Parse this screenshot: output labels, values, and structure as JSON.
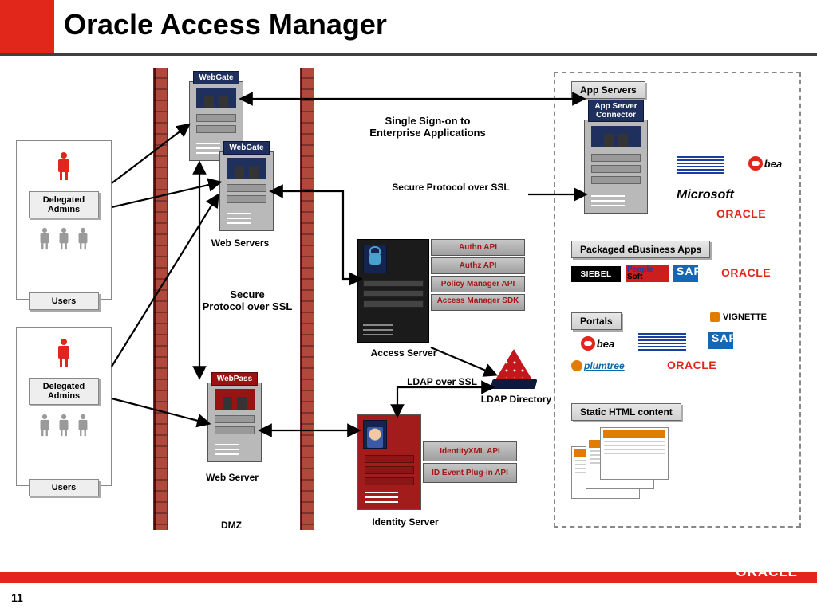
{
  "title": "Oracle Access Manager",
  "slide_number": "11",
  "footer_brand": "ORACLE",
  "left_groups": {
    "admins_label": "Delegated Admins",
    "users_label": "Users"
  },
  "dmz": {
    "label": "DMZ",
    "webgate_label": "WebGate",
    "webpass_label": "WebPass",
    "web_servers_label": "Web Servers",
    "web_server_label": "Web Server",
    "secure_protocol": "Secure\nProtocol over SSL"
  },
  "center": {
    "sso_text": "Single Sign-on to\nEnterprise Applications",
    "secure_protocol_ssl": "Secure  Protocol over SSL",
    "access_server_label": "Access Server",
    "api_rows": [
      "Authn API",
      "Authz API",
      "Policy  Manager API",
      "Access Manager SDK"
    ],
    "ldap_over_ssl": "LDAP over SSL",
    "ldap_directory": "LDAP Directory",
    "identity_server_label": "Identity Server",
    "identity_api_rows": [
      "IdentityXML API",
      "ID Event Plug-in API"
    ]
  },
  "right": {
    "app_servers": "App Servers",
    "app_server_connector": "App Server\nConnector",
    "packaged_apps": "Packaged eBusiness Apps",
    "portals": "Portals",
    "static_html": "Static HTML content",
    "vendors": {
      "ibm": "IBM",
      "bea": "bea",
      "microsoft": "Microsoft",
      "oracle": "ORACLE",
      "siebel": "SIEBEL",
      "peoplesoft_a": "People",
      "peoplesoft_b": "Soft",
      "sap": "SAP",
      "vignette": "VIGNETTE",
      "plumtree": "plumtree"
    }
  }
}
